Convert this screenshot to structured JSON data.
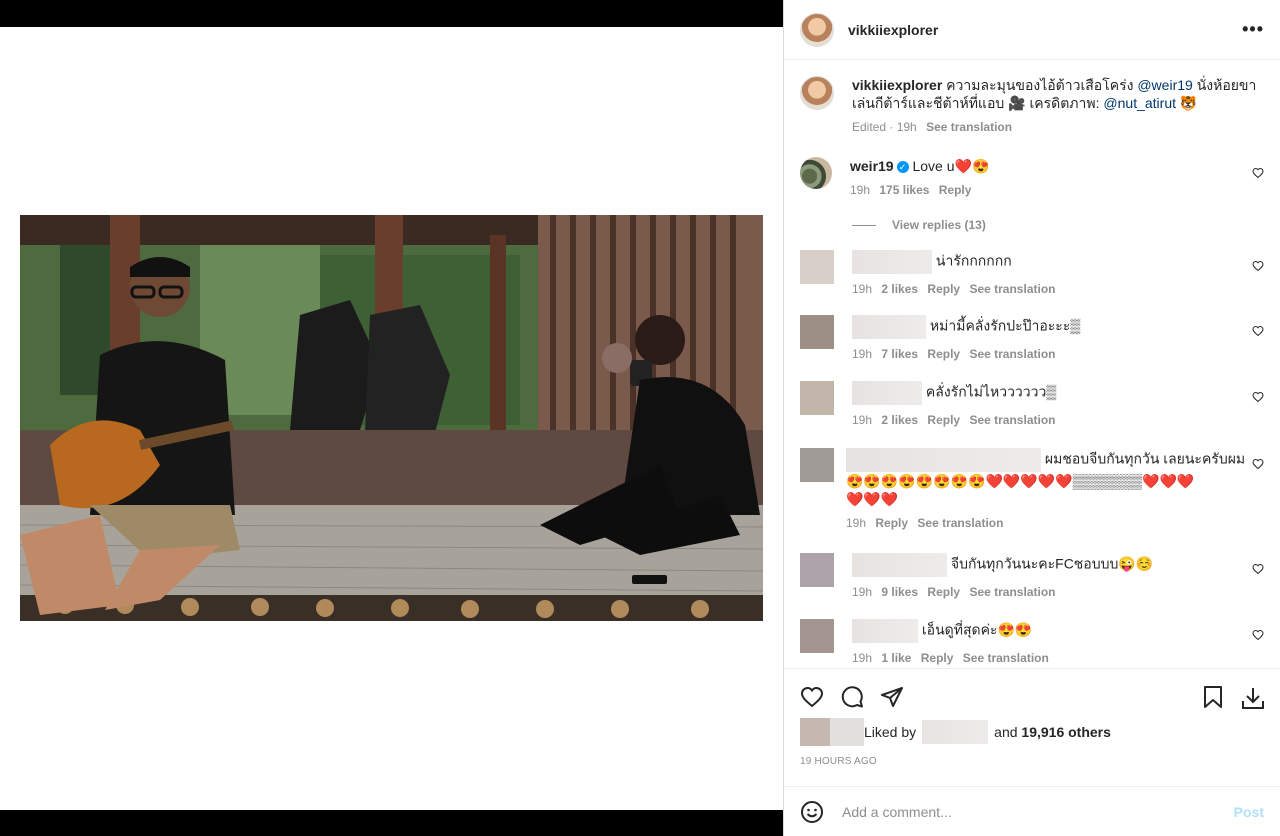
{
  "post": {
    "username": "vikkiiexplorer",
    "more_icon": "more-horizontal-icon",
    "caption": {
      "username": "vikkiiexplorer",
      "text": "ความละมุนของไอ้ต้าวเสือโคร่ง",
      "mention1": "@weir19",
      "text2": "นั่งห้อยขา",
      "line2": "เล่นกีต้าร์และชีต้าห์ที่แอบ 🎥 เครดิตภาพ:",
      "mention2": "@nut_atirut",
      "emoji": "🐯",
      "edited": "Edited · 19h",
      "see_translation": "See translation"
    }
  },
  "comments": [
    {
      "user": "weir19",
      "text": "Love u❤️😍",
      "time": "19h",
      "likes": "175 likes",
      "reply": "Reply"
    },
    {
      "text": "น่ารักกกกกก",
      "time": "19h",
      "likes": "2 likes",
      "reply": "Reply",
      "translate": "See translation"
    },
    {
      "text": "หม่ามี้คลั่งรักปะป๊าอะะะ▒",
      "time": "19h",
      "likes": "7 likes",
      "reply": "Reply",
      "translate": "See translation"
    },
    {
      "text": "คลั่งรักไม่ไหวววววว▒",
      "time": "19h",
      "likes": "2 likes",
      "reply": "Reply",
      "translate": "See translation"
    },
    {
      "text": "ผมชอบจีบกันทุกวัน เลยนะครับผม",
      "text_line2": "😍😍😍😍😍😍😍😍❤️❤️❤️❤️❤️▒▒▒▒▒▒▒❤️❤️❤️",
      "text_line3": "❤️❤️❤️",
      "time": "19h",
      "reply": "Reply",
      "translate": "See translation"
    },
    {
      "text": "จีบกันทุกวันนะคะFCชอบบบ😜☺️",
      "time": "19h",
      "likes": "9 likes",
      "reply": "Reply",
      "translate": "See translation"
    },
    {
      "text": "เอ็นดูที่สุดค่ะ😍😍",
      "time": "19h",
      "likes": "1 like",
      "reply": "Reply",
      "translate": "See translation"
    }
  ],
  "view_replies": "View replies (13)",
  "likes": {
    "prefix": "Liked by",
    "and": "and",
    "others": "19,916 others"
  },
  "timestamp": "19 HOURS AGO",
  "add_comment": {
    "placeholder": "Add a comment...",
    "post": "Post"
  },
  "icons": {
    "like": "heart-icon",
    "comment": "comment-icon",
    "share": "share-icon",
    "save": "bookmark-icon",
    "download": "download-icon",
    "emoji": "smiley-icon"
  }
}
